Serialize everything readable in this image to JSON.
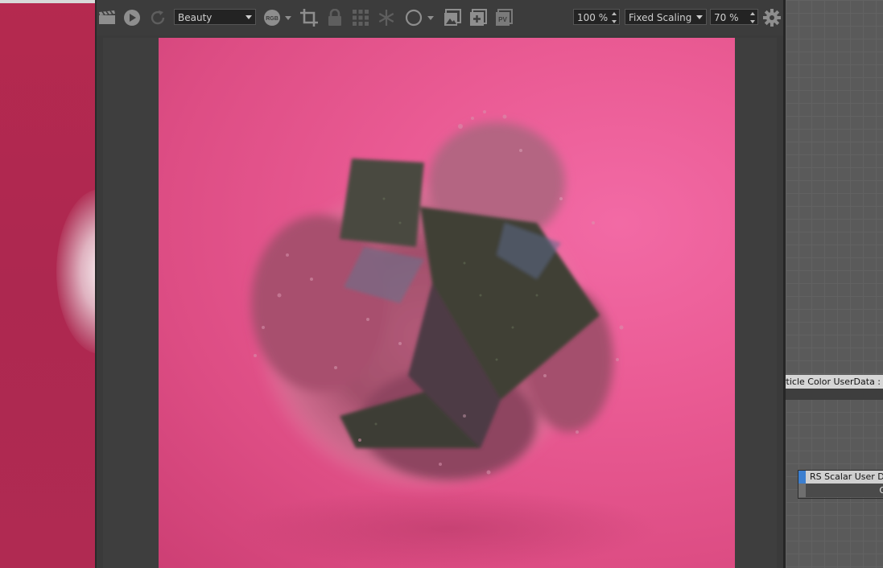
{
  "toolbar": {
    "pass_dropdown": "Beauty",
    "rgb_label": "RGB",
    "pv_label": "PV",
    "zoom_value": "100 %",
    "scaling_dropdown": "Fixed Scaling",
    "scale_value": "70 %"
  },
  "node_editor": {
    "node_particle_color": "rticle Color UserData : Co",
    "node_scalar_title": "RS Scalar User Dat",
    "node_scalar_output": "Ou"
  },
  "colors": {
    "render_background": "#ea5b94",
    "left_render_background": "#b02a52",
    "toolbar_background": "#3c3c3c",
    "node_editor_background": "#5a5a5a",
    "node_accent": "#3c7fd0"
  },
  "icons": [
    "clapper-icon",
    "play-icon",
    "refresh-icon",
    "rgb-icon",
    "crop-icon",
    "lock-icon",
    "grid-icon",
    "snowflake-icon",
    "circle-icon",
    "image-icon",
    "add-image-icon",
    "pv-icon",
    "gear-icon"
  ]
}
